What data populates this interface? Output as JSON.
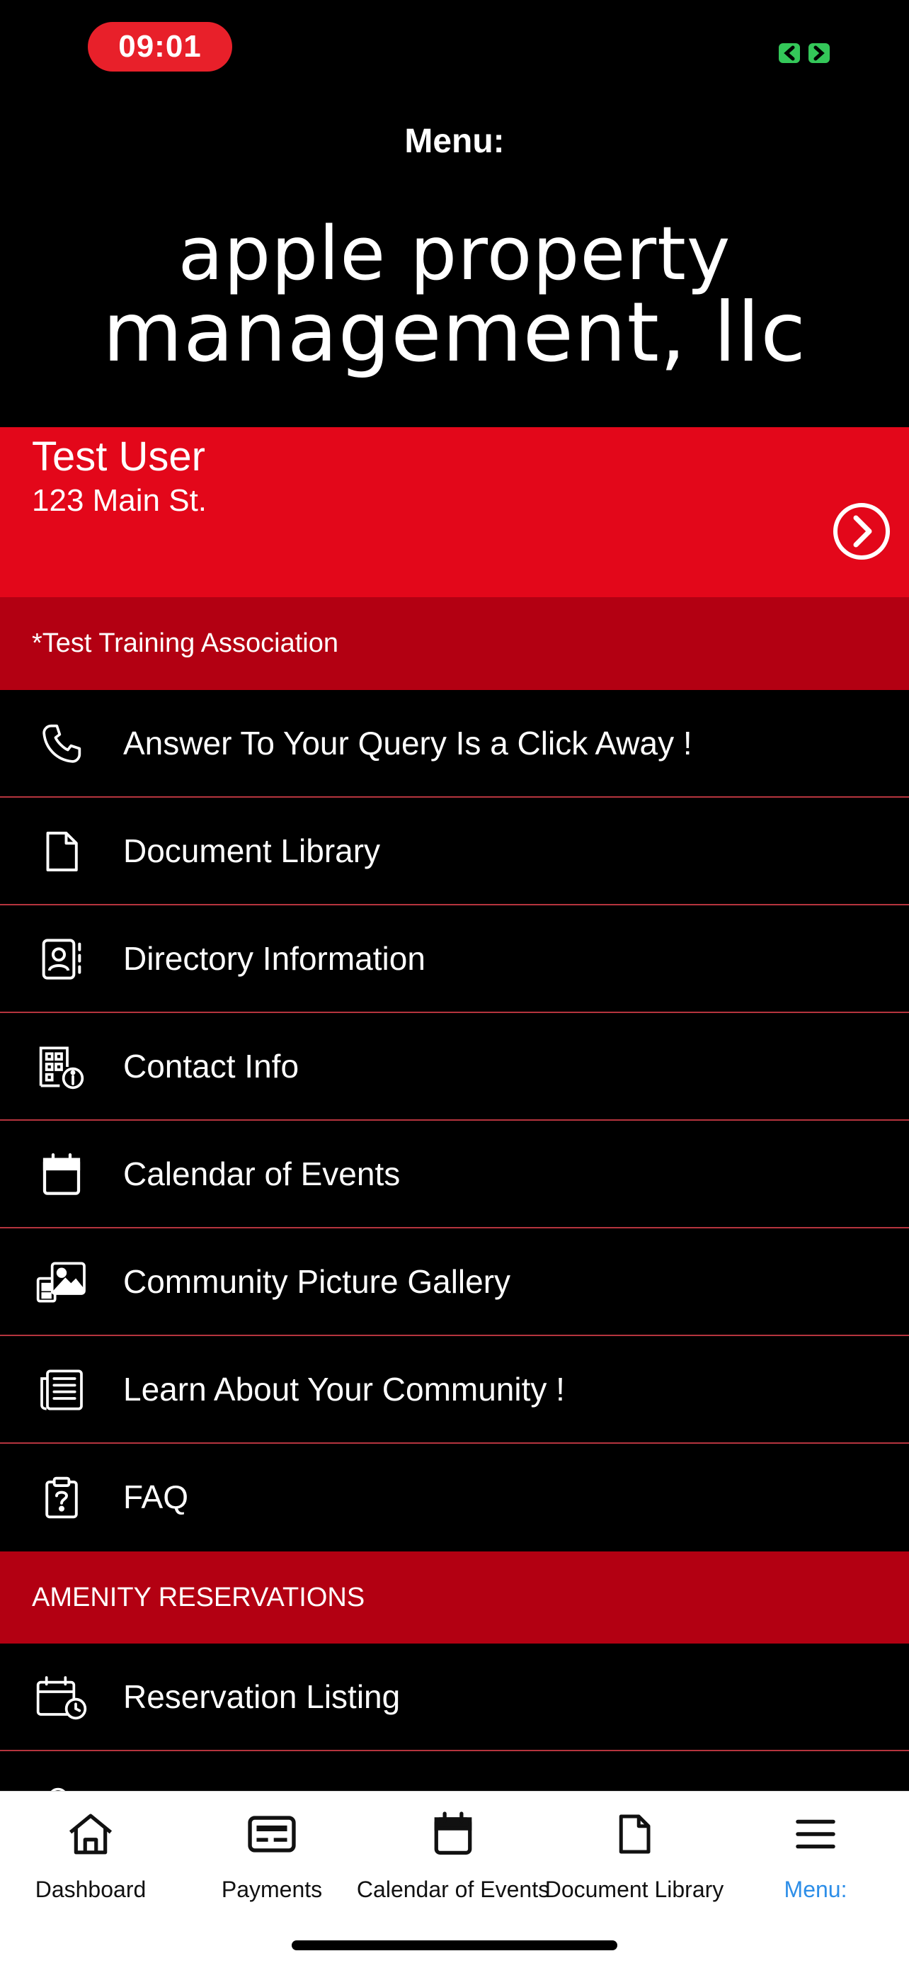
{
  "status_bar": {
    "time": "09:01",
    "call_icon": "phone-call-indicator-icon",
    "call_color": "#34c759"
  },
  "header": {
    "title": "Menu:",
    "logo_line1": "apple property",
    "logo_line2": "management, llc"
  },
  "user": {
    "name": "Test User",
    "address": "123 Main St.",
    "go_icon": "chevron-right-circle-icon"
  },
  "association": {
    "name": "*Test Training Association"
  },
  "menu": {
    "items": [
      {
        "label": "Answer To Your Query Is a Click Away !",
        "icon": "phone-icon"
      },
      {
        "label": "Document Library",
        "icon": "document-icon"
      },
      {
        "label": "Directory Information",
        "icon": "contact-book-icon"
      },
      {
        "label": "Contact Info",
        "icon": "building-info-icon"
      },
      {
        "label": "Calendar of Events",
        "icon": "calendar-icon"
      },
      {
        "label": "Community Picture Gallery",
        "icon": "gallery-icon"
      },
      {
        "label": "Learn About Your Community !",
        "icon": "newspaper-icon"
      },
      {
        "label": "FAQ",
        "icon": "clipboard-question-icon"
      }
    ],
    "section": {
      "title": "AMENITY RESERVATIONS",
      "items": [
        {
          "label": "Reservation Listing",
          "icon": "calendar-clock-icon"
        }
      ]
    }
  },
  "tab_bar": {
    "tabs": [
      {
        "label": "Dashboard",
        "icon": "home-icon"
      },
      {
        "label": "Payments",
        "icon": "payment-card-icon"
      },
      {
        "label": "Calendar of Events",
        "icon": "calendar-icon"
      },
      {
        "label": "Document Library",
        "icon": "document-icon"
      },
      {
        "label": "Menu:",
        "icon": "hamburger-menu-icon",
        "active": true
      }
    ],
    "active_color": "#2d8ee8"
  },
  "colors": {
    "brand_red": "#e3071a",
    "section_red": "#b30012",
    "divider": "#b5343e",
    "background": "#000000"
  }
}
